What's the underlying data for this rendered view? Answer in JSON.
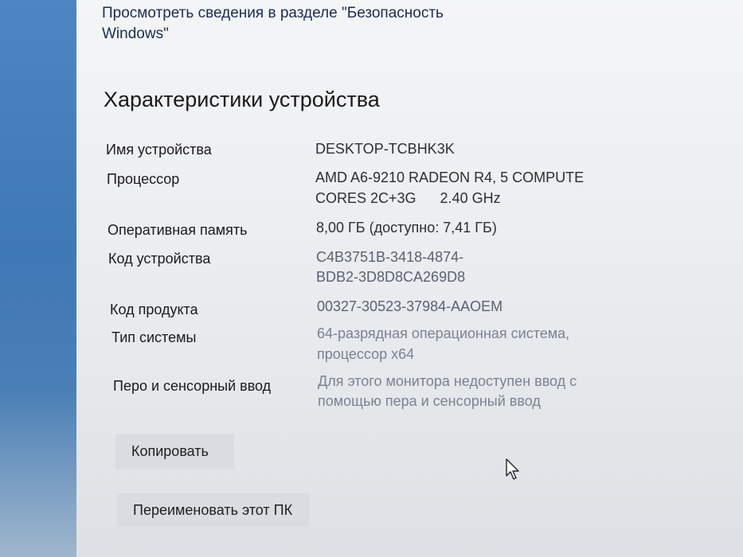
{
  "security_link": "Просмотреть сведения в разделе \"Безопасность Windows\"",
  "section_title": "Характеристики устройства",
  "specs": [
    {
      "label": "Имя устройства",
      "value": "DESKTOP-TCBHK3K"
    },
    {
      "label": "Процессор",
      "value_line1": "AMD A6-9210 RADEON R4, 5 COMPUTE",
      "value_line2": "CORES 2C+3G      2.40 GHz"
    },
    {
      "label": "Оперативная память",
      "value": "8,00 ГБ (доступно: 7,41 ГБ)"
    },
    {
      "label": "Код устройства",
      "value_line1": "C4B3751B-3418-4874-",
      "value_line2": "BDB2-3D8D8CA269D8"
    },
    {
      "label": "Код продукта",
      "value": "00327-30523-37984-AAOEM"
    },
    {
      "label": "Тип системы",
      "value_line1": "64-разрядная операционная система,",
      "value_line2": "процессор x64"
    },
    {
      "label": "Перо и сенсорный ввод",
      "value_line1": "Для этого монитора недоступен ввод с",
      "value_line2": "помощью пера и сенсорный ввод"
    }
  ],
  "buttons": {
    "copy": "Копировать",
    "rename": "Переименовать этот ПК"
  },
  "colors": {
    "desktop_blue": "#3f78b6",
    "panel_bg": "#eceef1",
    "button_bg": "#d9dce0",
    "link_color": "#1c2d52"
  },
  "icons": {
    "cursor": "mouse-pointer-icon"
  }
}
